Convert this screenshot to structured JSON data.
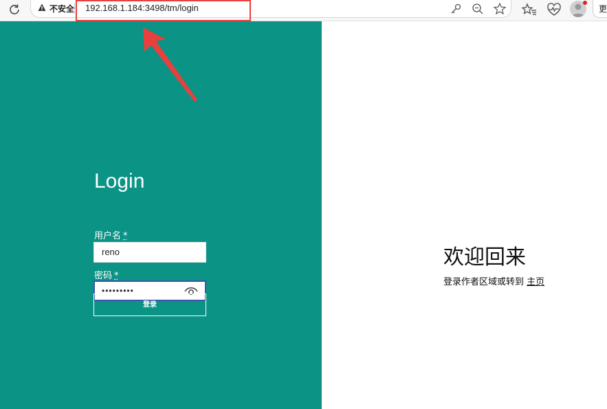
{
  "browser": {
    "security_label": "不安全",
    "url": "192.168.1.184:3498/tm/login",
    "more_label": "更"
  },
  "login": {
    "title": "Login",
    "username_label": "用户名",
    "password_label": "密码",
    "required_mark": "*",
    "username_value": "reno",
    "password_mask": "•••••••••",
    "submit_label": "登录"
  },
  "welcome": {
    "title": "欢迎回来",
    "subtitle": "登录作者区域或转到",
    "home_link": "主页"
  },
  "colors": {
    "panel": "#0b9386",
    "highlight": "#e8403c",
    "focus_border": "#3b55a8"
  }
}
